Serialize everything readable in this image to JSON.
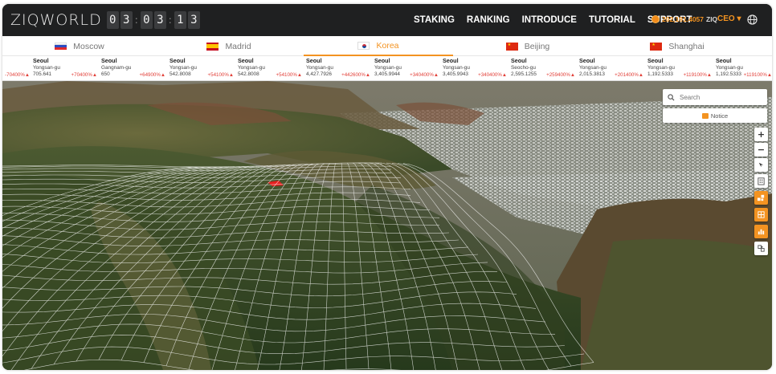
{
  "header": {
    "logo": "ZIQWORLD",
    "timer": [
      "0",
      "3",
      "0",
      "3",
      "1",
      "3"
    ],
    "nav": [
      "STAKING",
      "RANKING",
      "INTRODUCE",
      "TUTORIAL",
      "SUPPORT"
    ],
    "balance": "202,191.4057",
    "balance_unit": "ZIQ",
    "user": "CEO ▾",
    "globe_icon": "globe-icon"
  },
  "cities": [
    {
      "label": "Moscow",
      "flag": "russia"
    },
    {
      "label": "Madrid",
      "flag": "spain"
    },
    {
      "label": "Korea",
      "flag": "korea",
      "active": true
    },
    {
      "label": "Beijing",
      "flag": "china"
    },
    {
      "label": "Shanghai",
      "flag": "china"
    }
  ],
  "ticker": [
    {
      "city": "",
      "district": "",
      "value": "",
      "pct": "-70400%▲"
    },
    {
      "city": "Seoul",
      "district": "Yongsan-gu",
      "value": "705.641",
      "pct": "+70400%▲"
    },
    {
      "city": "Seoul",
      "district": "Gangnam-gu",
      "value": "650",
      "pct": "+64900%▲"
    },
    {
      "city": "Seoul",
      "district": "Yongsan-gu",
      "value": "542.8008",
      "pct": "+54100%▲"
    },
    {
      "city": "Seoul",
      "district": "Yongsan-gu",
      "value": "542.8008",
      "pct": "+54100%▲"
    },
    {
      "city": "Seoul",
      "district": "Yongsan-gu",
      "value": "4,427.7926",
      "pct": "+442600%▲"
    },
    {
      "city": "Seoul",
      "district": "Yongsan-gu",
      "value": "3,405.9944",
      "pct": "+340400%▲"
    },
    {
      "city": "Seoul",
      "district": "Yongsan-gu",
      "value": "3,405.9943",
      "pct": "+340400%▲"
    },
    {
      "city": "Seoul",
      "district": "Seocho-gu",
      "value": "2,595.1255",
      "pct": "+259400%▲"
    },
    {
      "city": "Seoul",
      "district": "Yongsan-gu",
      "value": "2,015.3813",
      "pct": "+201400%▲"
    },
    {
      "city": "Seoul",
      "district": "Yongsan-gu",
      "value": "1,192.5333",
      "pct": "+119100%▲"
    },
    {
      "city": "Seoul",
      "district": "Yongsan-gu",
      "value": "1,192.5333",
      "pct": "+119100%▲"
    }
  ],
  "map": {
    "search_placeholder": "Search",
    "notice_label": "Notice",
    "controls": [
      "zoom-in-button",
      "zoom-out-button",
      "compass-button",
      "map-layer-button",
      "layer-orange-1-button",
      "layer-orange-2-button",
      "layer-orange-3-button",
      "layer-grid-button"
    ],
    "zoom_in": "+",
    "zoom_out": "−"
  },
  "colors": {
    "accent": "#f39321",
    "topbar": "#1f2021",
    "alert": "#e2413a"
  }
}
